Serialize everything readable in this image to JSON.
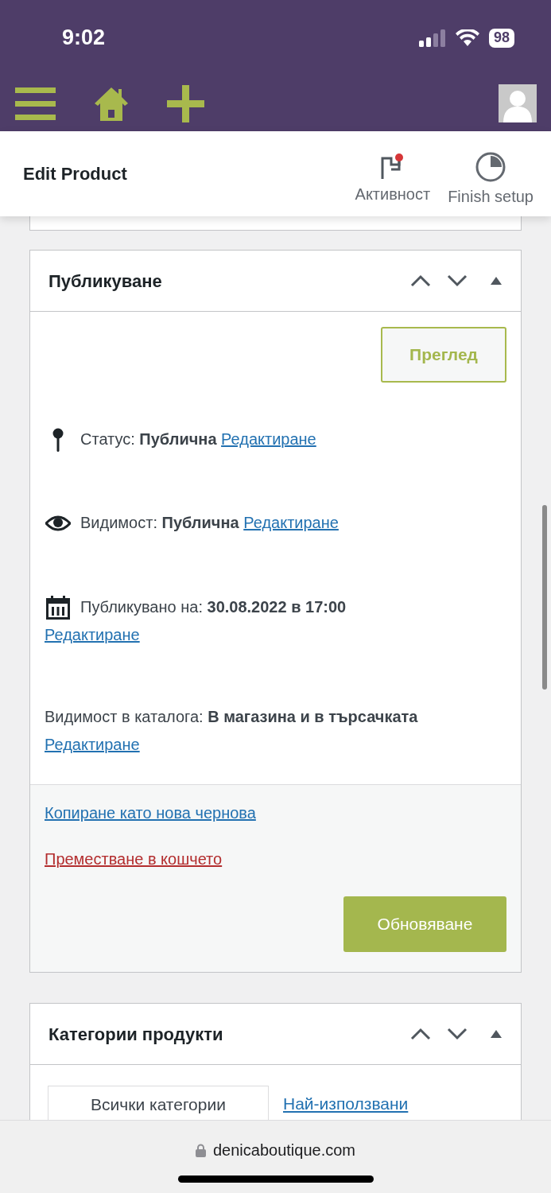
{
  "status_bar": {
    "time": "9:02",
    "battery": "98"
  },
  "header": {
    "title": "Edit Product",
    "actions": [
      {
        "kind": "activity",
        "label": "Активност",
        "badge": true
      },
      {
        "kind": "setup",
        "label": "Finish setup"
      }
    ]
  },
  "publish_box": {
    "title": "Публикуване",
    "preview_button": "Преглед",
    "rows": [
      {
        "kind": "status",
        "text": "Статус: **Публична**",
        "link": "Редактиране"
      },
      {
        "kind": "visibility",
        "text": "Видимост: **Публична**",
        "link": "Редактиране"
      },
      {
        "kind": "date",
        "text": "Публикувано на: **30.08.2022 в 17:00**",
        "link": "Редактиране"
      },
      {
        "kind": "catalog",
        "text": "Видимост в каталога: **В магазина и в търсачката**",
        "link": "Редактиране"
      }
    ],
    "copy_link": "Копиране като нова чернова",
    "trash_link": "Преместване в кошчето",
    "update_button": "Обновяване"
  },
  "categories_box": {
    "title": "Категории продукти",
    "tabs": [
      {
        "label": "Всички категории",
        "selected": true
      },
      {
        "label": "Най-използвани",
        "selected": false
      }
    ]
  },
  "browser_bar": {
    "url": "denicaboutique.com"
  }
}
